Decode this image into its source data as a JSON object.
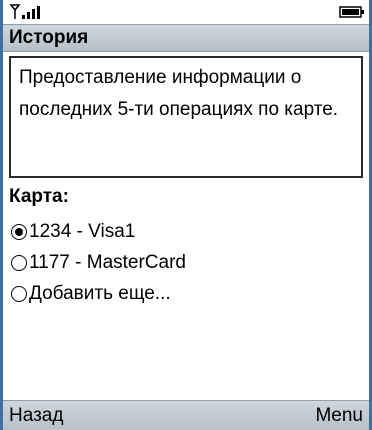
{
  "title": "История",
  "info_text": "Предоставление информации о последних 5-ти операциях по карте.",
  "card_label": "Карта:",
  "options": [
    {
      "label": "1234 - Visa1",
      "selected": true
    },
    {
      "label": "1177 - MasterCard",
      "selected": false
    },
    {
      "label": "Добавить еще...",
      "selected": false
    }
  ],
  "softkeys": {
    "left": "Назад",
    "right": "Menu"
  },
  "icons": {
    "signal": "signal-icon",
    "battery": "battery-icon"
  }
}
